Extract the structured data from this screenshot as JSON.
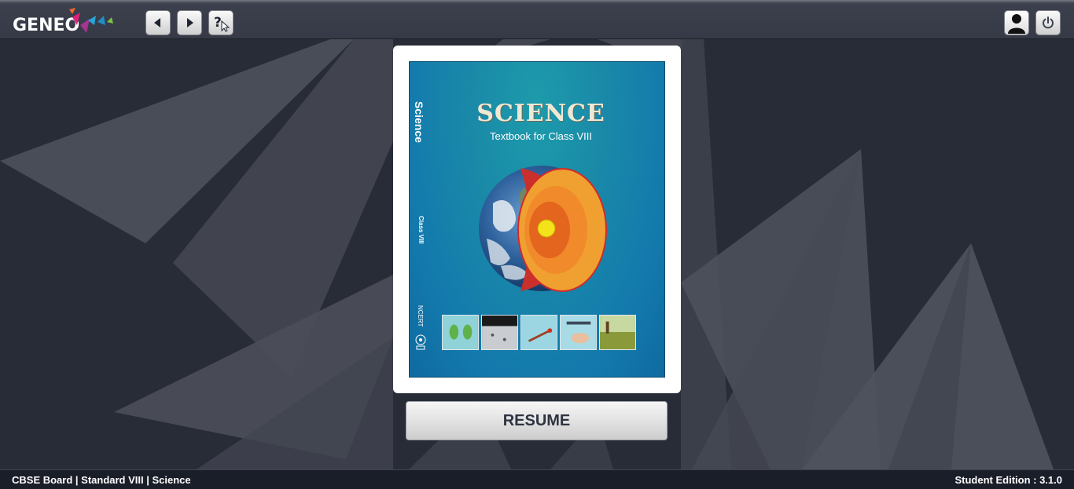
{
  "app": {
    "logo_text": "Geneo",
    "logo_icon": "geneo-triangles-logo"
  },
  "toolbar": {
    "back_icon": "back-arrow-icon",
    "forward_icon": "forward-arrow-icon",
    "help_icon": "help-cursor-icon",
    "profile_icon": "user-profile-icon",
    "power_icon": "power-icon"
  },
  "book": {
    "cover_title": "SCIENCE",
    "cover_subtitle": "Textbook for Class VIII",
    "spine_title": "Science",
    "spine_class": "Class VIII",
    "spine_publisher": "NCERT"
  },
  "actions": {
    "resume_label": "RESUME"
  },
  "footer": {
    "breadcrumb": "CBSE Board | Standard VIII | Science",
    "edition_label": "Student Edition : ",
    "version": "3.1.0"
  },
  "colors": {
    "background": "#2b2f3a",
    "topbar": "#3b404c",
    "footer": "#1a1e28",
    "cover_teal": "#1a8aa8",
    "earth_orange": "#f0a030"
  }
}
